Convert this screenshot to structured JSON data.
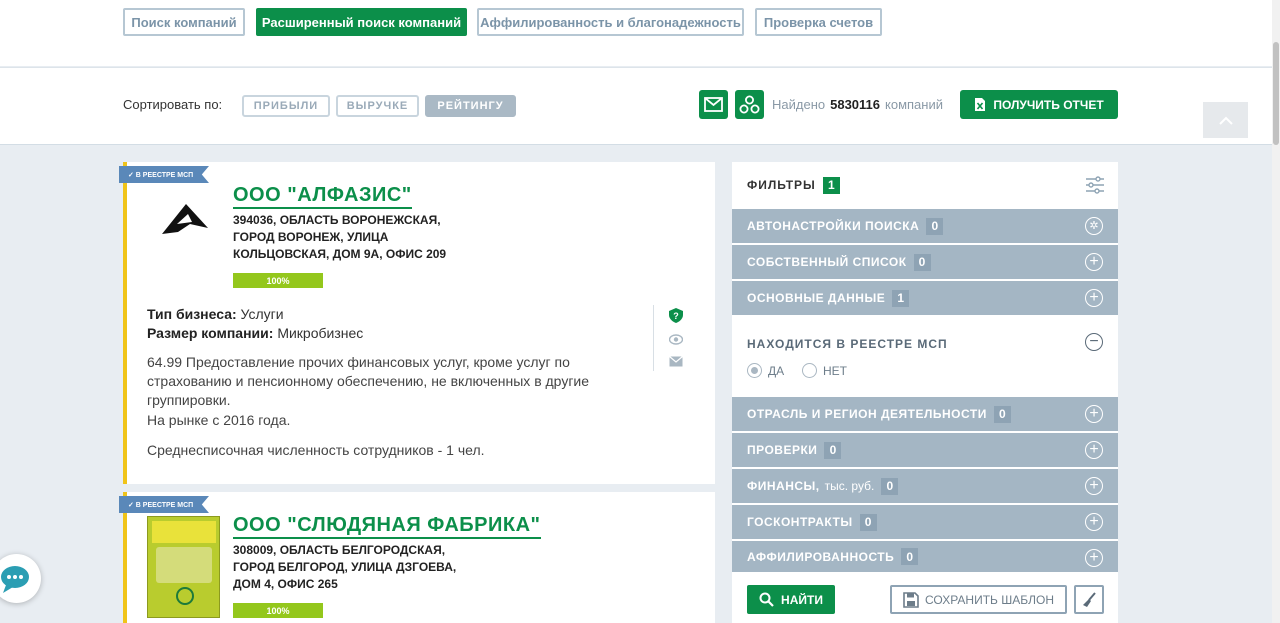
{
  "nav": {
    "tabs": [
      {
        "label": "Поиск компаний"
      },
      {
        "label": "Расширенный поиск компаний"
      },
      {
        "label": "Аффилированность и благонадежность"
      },
      {
        "label": "Проверка счетов"
      }
    ]
  },
  "sort": {
    "label": "Сортировать по:",
    "options": [
      "ПРИБЫЛИ",
      "ВЫРУЧКЕ",
      "РЕЙТИНГУ"
    ],
    "active": "РЕЙТИНГУ"
  },
  "results": {
    "found_prefix": "Найдено",
    "count": "5830116",
    "found_suffix": "компаний",
    "report_label": "ПОЛУЧИТЬ ОТЧЕТ"
  },
  "companies": [
    {
      "badge": "✓ В РЕЕСТРЕ МСП",
      "name": "ООО \"АЛФАЗИС\"",
      "address": "394036, ОБЛАСТЬ ВОРОНЕЖСКАЯ, ГОРОД ВОРОНЕЖ, УЛИЦА КОЛЬЦОВСКАЯ, ДОМ 9А, ОФИС 209",
      "rating": "100%",
      "rating_value": 1.0,
      "business_type_label": "Тип бизнеса:",
      "business_type": "Услуги",
      "size_label": "Размер компании:",
      "size": "Микробизнес",
      "activity": "64.99 Предоставление прочих финансовых услуг, кроме услуг по страхованию и пенсионному обеспечению, не включенных в другие группировки.",
      "since": "На рынке с 2016 года.",
      "employees": "Среднесписочная численность сотрудников - 1 чел."
    },
    {
      "badge": "✓ В РЕЕСТРЕ МСП",
      "name": "ООО \"СЛЮДЯНАЯ ФАБРИКА\"",
      "address": "308009, ОБЛАСТЬ БЕЛГОРОДСКАЯ, ГОРОД БЕЛГОРОД, УЛИЦА ДЗГОЕВА, ДОМ 4, ОФИС 265",
      "rating": "100%",
      "rating_value": 1.0
    }
  ],
  "filters": {
    "title": "ФИЛЬТРЫ",
    "count": "1",
    "rows_top": [
      {
        "label": "АВТОНАСТРОЙКИ ПОИСКА",
        "count": "0"
      },
      {
        "label": "СОБСТВЕННЫЙ СПИСОК",
        "count": "0"
      },
      {
        "label": "ОСНОВНЫЕ ДАННЫЕ",
        "count": "1"
      }
    ],
    "open": {
      "label": "НАХОДИТСЯ В РЕЕСТРЕ МСП",
      "yes": "ДА",
      "no": "НЕТ",
      "selected": "ДА"
    },
    "rows_bottom": [
      {
        "label": "ОТРАСЛЬ И РЕГИОН ДЕЯТЕЛЬНОСТИ",
        "count": "0"
      },
      {
        "label": "ПРОВЕРКИ",
        "count": "0"
      },
      {
        "label": "ФИНАНСЫ,",
        "sub": "тыс. руб.",
        "count": "0"
      },
      {
        "label": "ГОСКОНТРАКТЫ",
        "count": "0"
      },
      {
        "label": "АФФИЛИРОВАННОСТЬ",
        "count": "0"
      }
    ],
    "find_label": "НАЙТИ",
    "save_label": "СОХРАНИТЬ ШАБЛОН"
  },
  "colors": {
    "accent": "#0c8f4a",
    "filter_row": "#a4b6c4",
    "badge": "#5a88b9",
    "rating_bar": "#94c71c",
    "card_border": "#f0c419"
  },
  "icons": [
    "mail-icon",
    "network-icon",
    "report-icon",
    "chevron-up-icon",
    "shield-check-icon",
    "eye-icon",
    "envelope-icon",
    "filter-settings-icon",
    "search-icon",
    "save-icon",
    "broom-icon",
    "chat-icon"
  ]
}
